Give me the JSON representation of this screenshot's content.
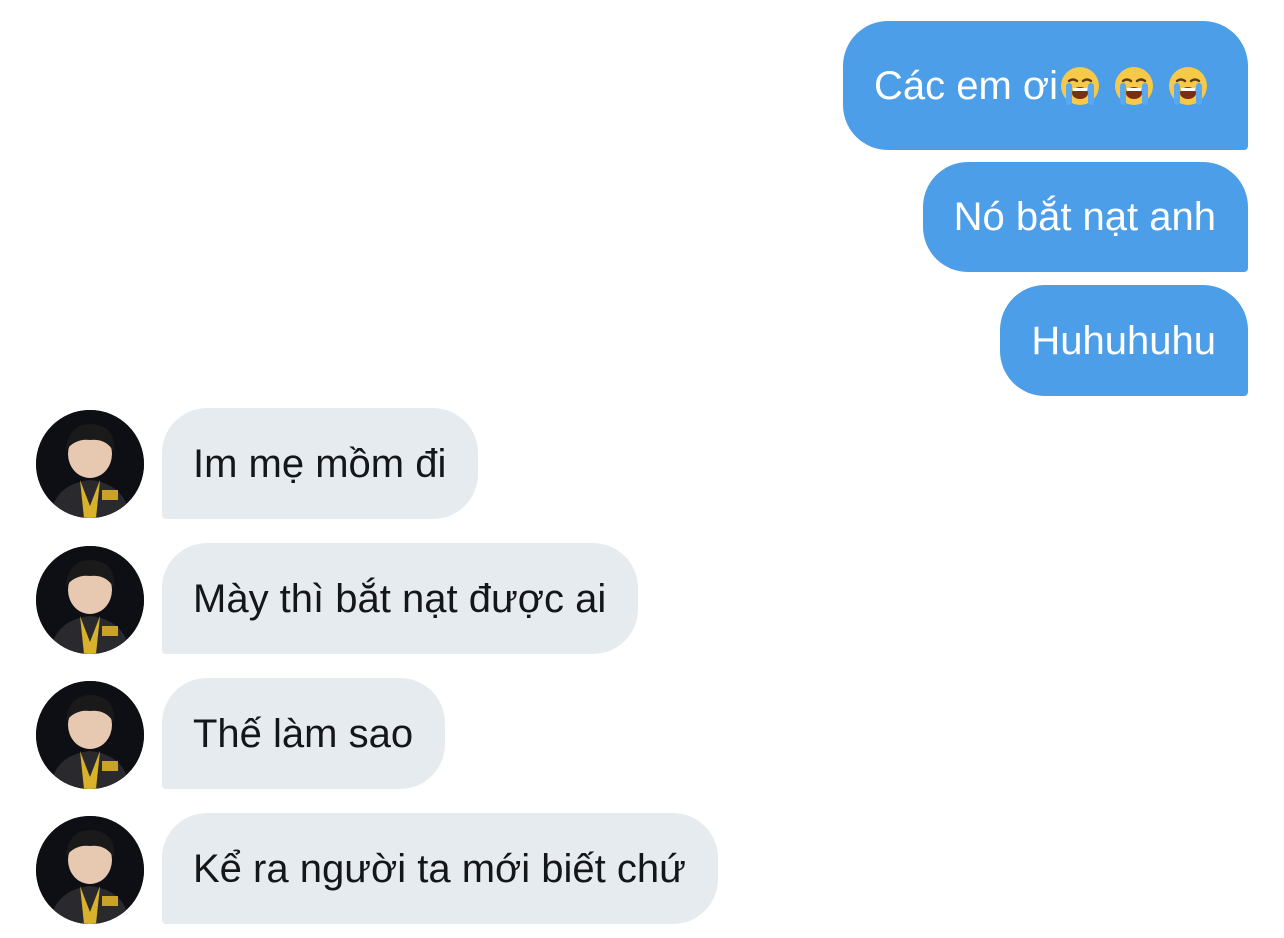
{
  "conversation": {
    "outgoing": [
      {
        "text": "Các em ơi",
        "emojis": [
          "loudly-crying-face",
          "loudly-crying-face",
          "loudly-crying-face"
        ]
      },
      {
        "text": "Nó bắt nạt anh"
      },
      {
        "text": "Huhuhuhu"
      }
    ],
    "incoming": [
      {
        "text": "Im mẹ mồm đi",
        "avatar": "user-avatar"
      },
      {
        "text": "Mày thì bắt nạt được ai",
        "avatar": "user-avatar"
      },
      {
        "text": "Thế làm sao",
        "avatar": "user-avatar"
      },
      {
        "text": "Kể ra người ta mới biết chứ",
        "avatar": "user-avatar"
      }
    ]
  },
  "colors": {
    "outgoing_bubble": "#4c9ee8",
    "incoming_bubble": "#e6ebef",
    "outgoing_text": "#ffffff",
    "incoming_text": "#14171a"
  }
}
